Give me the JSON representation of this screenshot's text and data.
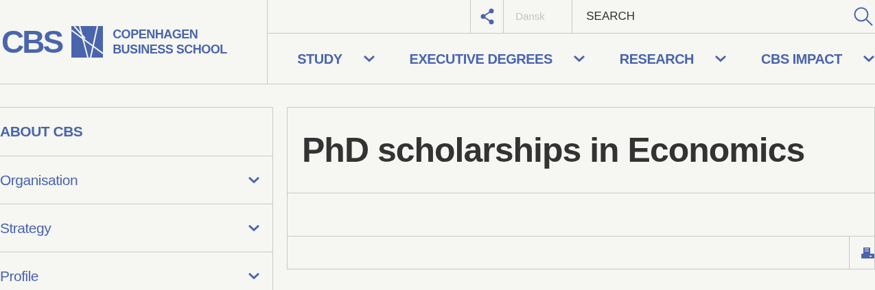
{
  "logo": {
    "mark": "CBS",
    "line_1": "COPENHAGEN",
    "line_2": "BUSINESS SCHOOL"
  },
  "top_bar": {
    "language": "Dansk",
    "search": {
      "placeholder": "SEARCH"
    }
  },
  "nav": [
    {
      "label": "STUDY"
    },
    {
      "label": "EXECUTIVE DEGREES"
    },
    {
      "label": "RESEARCH"
    },
    {
      "label": "CBS IMPACT"
    }
  ],
  "sidebar": {
    "title": "ABOUT CBS",
    "items": [
      {
        "label": "Organisation"
      },
      {
        "label": "Strategy"
      },
      {
        "label": "Profile"
      }
    ]
  },
  "page": {
    "title": "PhD scholarships in Economics"
  }
}
